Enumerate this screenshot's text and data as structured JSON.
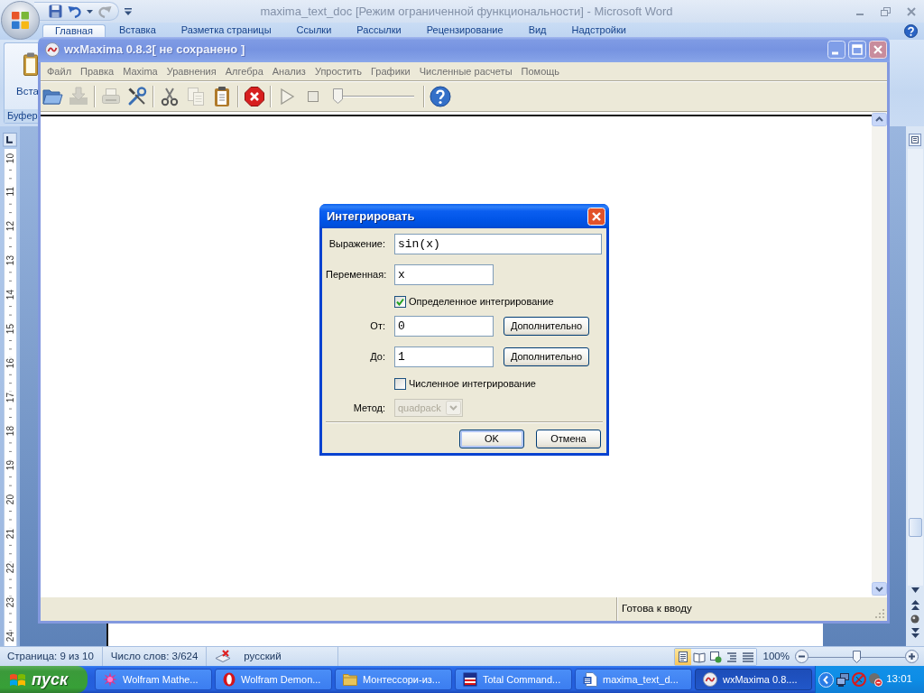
{
  "word": {
    "title": "maxima_text_doc [Режим ограниченной функциональности] - Microsoft Word",
    "quick_access": [
      {
        "disabled": false
      },
      {
        "disabled": false
      },
      {
        "disabled": true
      }
    ],
    "ribbon_tabs": [
      {
        "label": "Главная",
        "selected": true
      },
      {
        "label": "Вставка",
        "selected": false
      },
      {
        "label": "Разметка страницы",
        "selected": false
      },
      {
        "label": "Ссылки",
        "selected": false
      },
      {
        "label": "Рассылки",
        "selected": false
      },
      {
        "label": "Рецензирование",
        "selected": false
      },
      {
        "label": "Вид",
        "selected": false
      },
      {
        "label": "Надстройки",
        "selected": false
      }
    ],
    "paste_label": "Вста",
    "group_label": "Буфер",
    "ruler": [
      "10",
      "11",
      "12",
      "13",
      "14",
      "15",
      "16",
      "17",
      "18",
      "19",
      "20",
      "21",
      "22",
      "23",
      "24"
    ],
    "status_bar": {
      "page": "Страница: 9 из 10",
      "words": "Число слов: 3/624",
      "language": "русский",
      "views": [
        {
          "selected": true
        },
        {
          "selected": false
        },
        {
          "selected": false
        },
        {
          "selected": false
        },
        {
          "selected": false
        }
      ],
      "zoom": "100%",
      "zoom_slider": {
        "level": 0.5
      }
    }
  },
  "wxmaxima": {
    "title": "wxMaxima 0.8.3[ не сохранено ]",
    "menu": [
      "Файл",
      "Правка",
      "Maxima",
      "Уравнения",
      "Алгебра",
      "Анализ",
      "Упростить",
      "Графики",
      "Численные расчеты",
      "Помощь"
    ],
    "toolbar": [
      {
        "kind": "button",
        "disabled": false
      },
      {
        "kind": "button",
        "disabled": true
      },
      {
        "kind": "separator"
      },
      {
        "kind": "button",
        "disabled": true
      },
      {
        "kind": "button",
        "disabled": false
      },
      {
        "kind": "separator"
      },
      {
        "kind": "button",
        "disabled": false
      },
      {
        "kind": "button",
        "disabled": true
      },
      {
        "kind": "button",
        "disabled": false
      },
      {
        "kind": "separator"
      },
      {
        "kind": "button",
        "disabled": false
      },
      {
        "kind": "separator"
      },
      {
        "kind": "button",
        "disabled": true
      },
      {
        "kind": "button",
        "disabled": true
      },
      {
        "kind": "slider",
        "level": 0
      },
      {
        "kind": "separator"
      },
      {
        "kind": "button",
        "disabled": false
      }
    ],
    "status": "Готова к вводу"
  },
  "dialog": {
    "title": "Интегрировать",
    "rows": [
      {
        "kind": "longfield",
        "label": "Выражение:",
        "value": "sin(x)"
      },
      {
        "kind": "field",
        "label": "Переменная:",
        "value": "x"
      },
      {
        "kind": "check",
        "label": "Определенное интегрирование",
        "checked": true
      },
      {
        "kind": "bound",
        "label": "От:",
        "value": "0",
        "button": "Дополнительно"
      },
      {
        "kind": "bound",
        "label": "До:",
        "value": "1",
        "button": "Дополнительно"
      },
      {
        "kind": "check",
        "label": "Численное интегрирование",
        "checked": false
      },
      {
        "kind": "combo",
        "label": "Метод:",
        "value": "quadpack",
        "disabled": true
      }
    ],
    "buttons": [
      {
        "label": "OK",
        "default": true
      },
      {
        "label": "Отмена",
        "default": false
      }
    ]
  },
  "taskbar": {
    "start": "пуск",
    "tasks": [
      {
        "label": "Wolfram Mathe...",
        "selected": false
      },
      {
        "label": "Wolfram Demon...",
        "selected": false
      },
      {
        "label": "Монтессори-из...",
        "selected": false
      },
      {
        "label": "Total Command...",
        "selected": false
      },
      {
        "label": "maxima_text_d...",
        "selected": false
      },
      {
        "label": "wxMaxima 0.8....",
        "selected": true
      }
    ],
    "clock": "13:01"
  }
}
